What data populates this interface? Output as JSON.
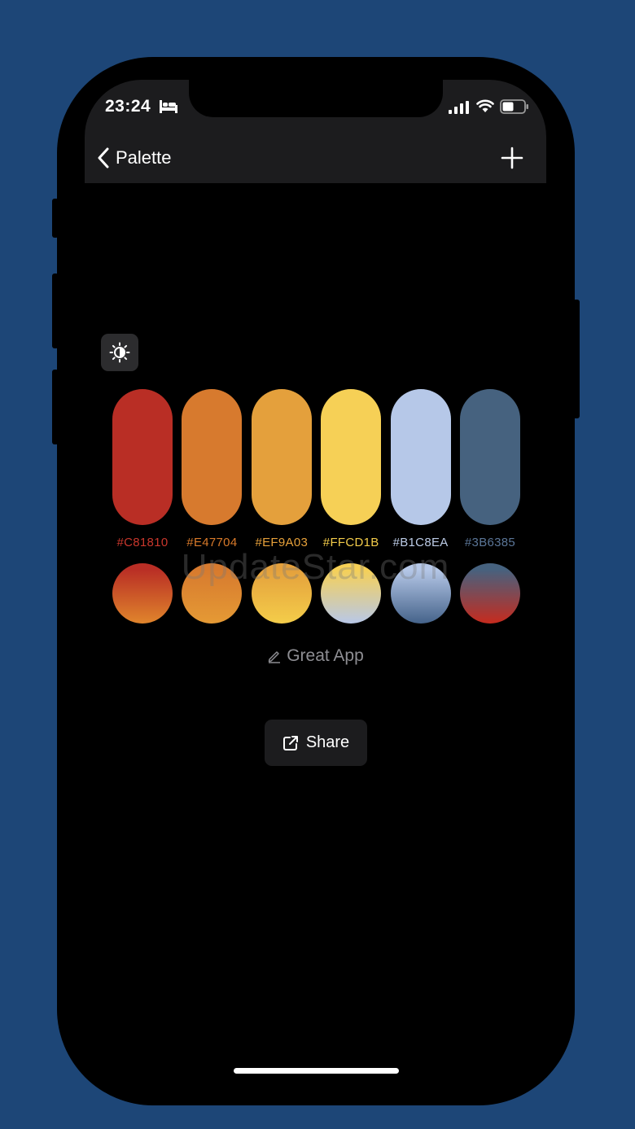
{
  "status_bar": {
    "time": "23:24"
  },
  "nav": {
    "back_label": "Palette"
  },
  "palette": {
    "colors": [
      {
        "hex": "#C81810",
        "swatch": "#b92e25",
        "label_color": "#c9372c",
        "gradient_to": "#e0852c"
      },
      {
        "hex": "#E47704",
        "swatch": "#d77a2e",
        "label_color": "#d97a2a",
        "gradient_to": "#e59a35"
      },
      {
        "hex": "#EF9A03",
        "swatch": "#e4a03c",
        "label_color": "#e6a03a",
        "gradient_to": "#f4cd4a"
      },
      {
        "hex": "#FFCD1B",
        "swatch": "#f6d056",
        "label_color": "#f3cc4a",
        "gradient_to": "#b8c8e8"
      },
      {
        "hex": "#B1C8EA",
        "swatch": "#b6c8e8",
        "label_color": "#bccbe6",
        "gradient_to": "#45638a"
      },
      {
        "hex": "#3B6385",
        "swatch": "#46627f",
        "label_color": "#5b7698",
        "gradient_to": "#c62b1e"
      }
    ],
    "name": "Great App"
  },
  "watermark": "UpdateStar.com",
  "share": {
    "label": "Share"
  },
  "theme": {
    "background": "#1d4677",
    "header": "#1c1c1e",
    "button": "#2c2c2e"
  }
}
